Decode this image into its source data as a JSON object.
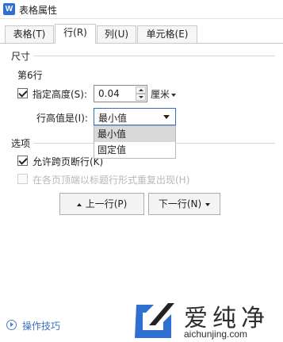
{
  "window": {
    "title": "表格属性",
    "app_icon_letter": "W"
  },
  "tabs": [
    {
      "label": "表格(T)",
      "active": false
    },
    {
      "label": "行(R)",
      "active": true
    },
    {
      "label": "列(U)",
      "active": false
    },
    {
      "label": "单元格(E)",
      "active": false
    }
  ],
  "size_section": {
    "title": "尺寸",
    "row_label": "第6行",
    "height_checkbox": {
      "label": "指定高度(S):",
      "checked": true
    },
    "height_value": "0.04",
    "unit": "厘米",
    "height_rule_label": "行高值是(I):",
    "height_rule_selected": "最小值",
    "height_rule_options": [
      "最小值",
      "固定值"
    ]
  },
  "options_section": {
    "title": "选项",
    "allow_break": {
      "label": "允许跨页断行(K)",
      "checked": true
    },
    "repeat_header": {
      "label": "在各页顶端以标题行形式重复出现(H)",
      "checked": false,
      "disabled": true
    }
  },
  "buttons": {
    "prev_row": "上一行(P)",
    "next_row": "下一行(N)"
  },
  "footer": {
    "tips": "操作技巧"
  },
  "watermark": {
    "name": "爱纯净",
    "url": "aichunjing.com",
    "color": "#2f6fd1"
  }
}
